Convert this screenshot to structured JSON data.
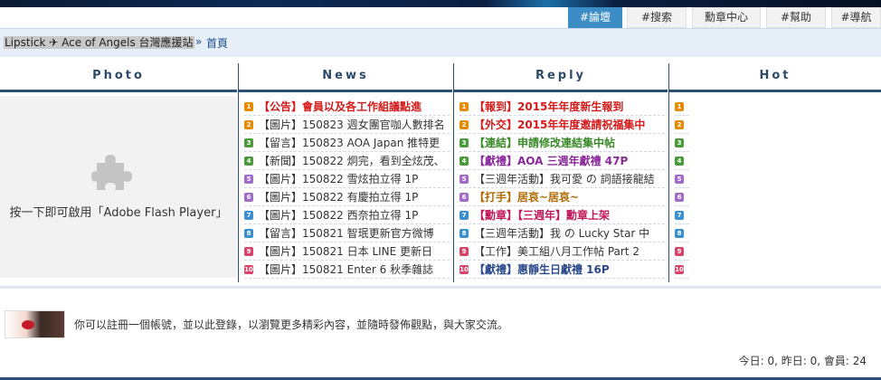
{
  "nav": {
    "items": [
      {
        "label": "#論壇",
        "active": true
      },
      {
        "label": "#搜索",
        "active": false
      },
      {
        "label": "勳章中心",
        "active": false
      },
      {
        "label": "#幫助",
        "active": false
      },
      {
        "label": "#導航",
        "active": false
      }
    ]
  },
  "breadcrumb": {
    "site": "Lipstick ✈ Ace of Angels 台灣應援站",
    "separator": "»",
    "home": "首頁"
  },
  "columns": {
    "photo": "Photo",
    "news": "News",
    "reply": "Reply",
    "hot": "Hot"
  },
  "photo": {
    "plugin_icon": "puzzle-icon",
    "plugin_text": "按一下即可啟用「Adobe Flash Player」"
  },
  "rank_colors": [
    "#e68a00",
    "#e68a00",
    "#4a9a3c",
    "#4a9a3c",
    "#a16cc7",
    "#a16cc7",
    "#3a8fd0",
    "#3a8fd0",
    "#d9436a",
    "#d9436a"
  ],
  "news": [
    {
      "num": "1",
      "text": "【公告】會員以及各工作組議點進",
      "color": "#d41a1a",
      "bold": true
    },
    {
      "num": "2",
      "text": "【圖片】150823 週女團官咖人數排名",
      "color": "#333333",
      "bold": false
    },
    {
      "num": "3",
      "text": "【留言】150823 AOA Japan 推特更",
      "color": "#333333",
      "bold": false
    },
    {
      "num": "4",
      "text": "【新聞】150822 炯完，看到全炫茂、",
      "color": "#333333",
      "bold": false
    },
    {
      "num": "5",
      "text": "【圖片】150822 雪炫拍立得 1P",
      "color": "#333333",
      "bold": false
    },
    {
      "num": "6",
      "text": "【圖片】150822 有慶拍立得 1P",
      "color": "#333333",
      "bold": false
    },
    {
      "num": "7",
      "text": "【圖片】150822 西奈拍立得 1P",
      "color": "#333333",
      "bold": false
    },
    {
      "num": "8",
      "text": "【留言】150821 智珉更新官方微博",
      "color": "#333333",
      "bold": false
    },
    {
      "num": "9",
      "text": "【圖片】150821 日本 LINE 更新日",
      "color": "#333333",
      "bold": false
    },
    {
      "num": "10",
      "text": "【圖片】150821 Enter 6 秋季雜誌",
      "color": "#333333",
      "bold": false
    }
  ],
  "reply": [
    {
      "num": "1",
      "text": "【報到】2015年年度新生報到",
      "color": "#d41a1a",
      "bold": true
    },
    {
      "num": "2",
      "text": "【外交】2015年年度邀請祝福集中",
      "color": "#d41a1a",
      "bold": true
    },
    {
      "num": "3",
      "text": "【連結】申請修改連結集中帖",
      "color": "#3a8a2a",
      "bold": true
    },
    {
      "num": "4",
      "text": "【獻禮】AOA 三週年獻禮 47P",
      "color": "#8a2a9a",
      "bold": true
    },
    {
      "num": "5",
      "text": "【三週年活動】我可愛 の 詞語接龍結",
      "color": "#333333",
      "bold": false
    },
    {
      "num": "6",
      "text": "【打手】居哀~居哀~",
      "color": "#b06a00",
      "bold": true
    },
    {
      "num": "7",
      "text": "【勳章】【三週年】勳章上架",
      "color": "#c0185a",
      "bold": true
    },
    {
      "num": "8",
      "text": "【三週年活動】我 の Lucky Star 中",
      "color": "#333333",
      "bold": false
    },
    {
      "num": "9",
      "text": "【工作】美工組八月工作帖 Part 2",
      "color": "#333333",
      "bold": false
    },
    {
      "num": "10",
      "text": "【獻禮】惠靜生日獻禮 16P",
      "color": "#2a4a8a",
      "bold": true
    }
  ],
  "hot": [
    {
      "num": "1"
    },
    {
      "num": "2"
    },
    {
      "num": "3"
    },
    {
      "num": "4"
    },
    {
      "num": "5"
    },
    {
      "num": "6"
    },
    {
      "num": "7"
    },
    {
      "num": "8"
    },
    {
      "num": "9"
    },
    {
      "num": "10"
    }
  ],
  "footer": {
    "invite_text": "你可以註冊一個帳號，並以此登錄，以瀏覽更多精彩內容，並隨時發佈觀點，與大家交流。",
    "stats": "今日: 0, 昨日: 0, 會員: 24"
  }
}
